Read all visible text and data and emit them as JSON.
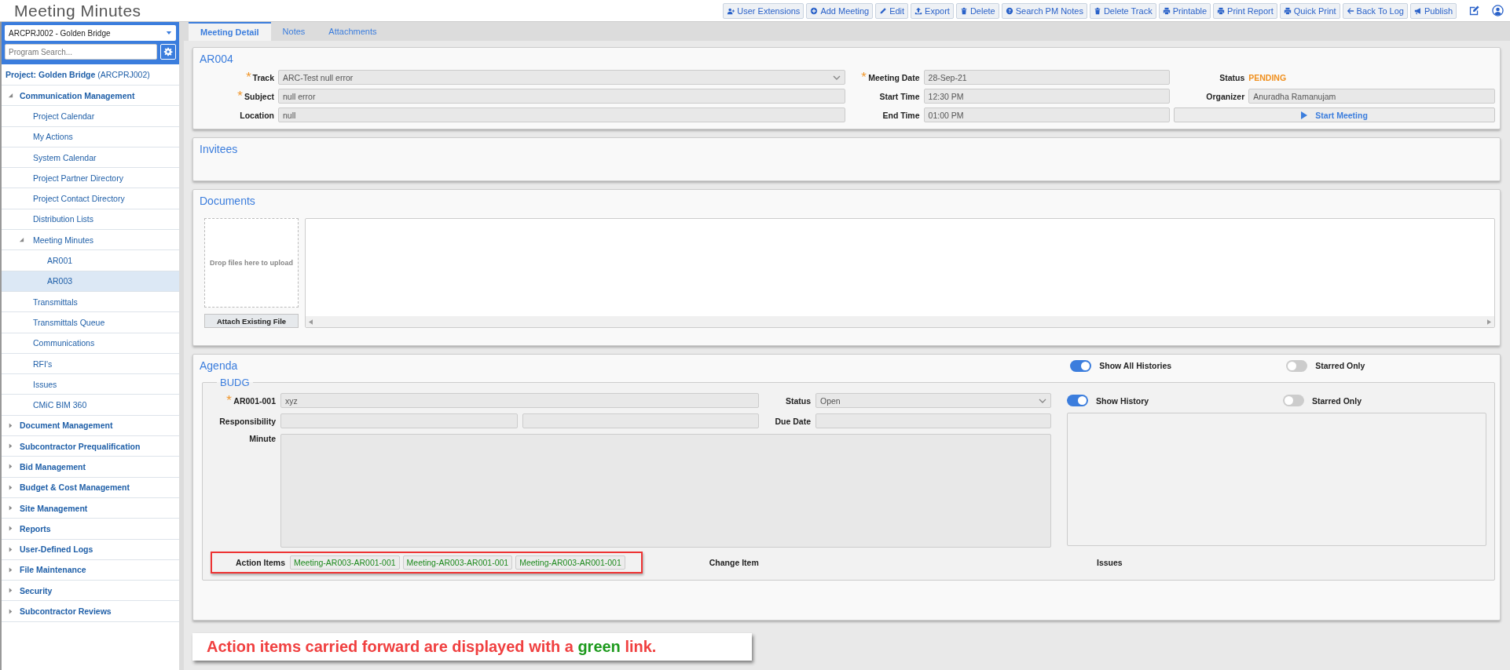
{
  "app_title": "Meeting Minutes",
  "toolbar": [
    {
      "label": "User Extensions"
    },
    {
      "label": "Add Meeting"
    },
    {
      "label": "Edit"
    },
    {
      "label": "Export"
    },
    {
      "label": "Delete"
    },
    {
      "label": "Search PM Notes"
    },
    {
      "label": "Delete Track"
    },
    {
      "label": "Printable"
    },
    {
      "label": "Print Report"
    },
    {
      "label": "Quick Print"
    },
    {
      "label": "Back To Log"
    },
    {
      "label": "Publish"
    }
  ],
  "sidebar": {
    "project_selector": "ARCPRJ002 - Golden Bridge",
    "search_placeholder": "Program Search...",
    "project_label": "**Project: Golden Bridge** (ARCPRJ002)",
    "tree": [
      {
        "label": "Communication Management",
        "expanded": true,
        "selected": false,
        "children": [
          {
            "label": "Project Calendar",
            "selected": false
          },
          {
            "label": "My Actions",
            "selected": false
          },
          {
            "label": "System Calendar",
            "selected": false
          },
          {
            "label": "Project Partner Directory",
            "selected": false
          },
          {
            "label": "Project Contact Directory",
            "selected": false
          },
          {
            "label": "Distribution Lists",
            "selected": false
          },
          {
            "label": "Meeting Minutes",
            "selected": false,
            "expanded": true,
            "children": [
              {
                "label": "AR001",
                "selected": false
              },
              {
                "label": "AR003",
                "selected": true
              }
            ]
          },
          {
            "label": "Transmittals",
            "selected": false
          },
          {
            "label": "Transmittals Queue",
            "selected": false
          },
          {
            "label": "Communications",
            "selected": false
          },
          {
            "label": "RFI's",
            "selected": false
          },
          {
            "label": "Issues",
            "selected": false
          },
          {
            "label": "CMiC BIM 360",
            "selected": false
          }
        ]
      },
      {
        "label": "Document Management",
        "expanded": false,
        "selected": false
      },
      {
        "label": "Subcontractor Prequalification",
        "expanded": false,
        "selected": false
      },
      {
        "label": "Bid Management",
        "expanded": false,
        "selected": false
      },
      {
        "label": "Budget & Cost Management",
        "expanded": false,
        "selected": false
      },
      {
        "label": "Site Management",
        "expanded": false,
        "selected": false
      },
      {
        "label": "Reports",
        "expanded": false,
        "selected": false
      },
      {
        "label": "User-Defined Logs",
        "expanded": false,
        "selected": false
      },
      {
        "label": "File Maintenance",
        "expanded": false,
        "selected": false
      },
      {
        "label": "Security",
        "expanded": false,
        "selected": false
      },
      {
        "label": "Subcontractor Reviews",
        "expanded": false,
        "selected": false
      }
    ]
  },
  "tabs": [
    {
      "label": "Meeting Detail",
      "selected": true
    },
    {
      "label": "Notes",
      "selected": false
    },
    {
      "label": "Attachments",
      "selected": false
    }
  ],
  "detail": {
    "title": "AR004",
    "fields": [
      {
        "label": "Track",
        "value": "ARC-Test null error",
        "required": true,
        "kind": "select"
      },
      {
        "label": "Meeting Date",
        "value": "28-Sep-21",
        "required": true,
        "kind": "text"
      },
      {
        "label": "Status",
        "value": "PENDING",
        "required": false,
        "kind": "status"
      },
      {
        "label": "Subject",
        "value": "null error",
        "required": true,
        "kind": "text"
      },
      {
        "label": "Start Time",
        "value": "12:30 PM",
        "required": false,
        "kind": "text"
      },
      {
        "label": "Organizer",
        "value": "Anuradha Ramanujam",
        "required": false,
        "kind": "text"
      },
      {
        "label": "Location",
        "value": "null",
        "required": false,
        "kind": "text"
      },
      {
        "label": "End Time",
        "value": "01:00 PM",
        "required": false,
        "kind": "text"
      }
    ],
    "start_button": "Start Meeting"
  },
  "invitees": {
    "title": "Invitees"
  },
  "documents": {
    "title": "Documents",
    "dropzone": "Drop files here to upload",
    "attach_button": "Attach Existing File"
  },
  "agenda": {
    "title": "Agenda",
    "toggles": [
      {
        "label": "Show All Histories",
        "on": true
      },
      {
        "label": "Starred Only",
        "on": false
      }
    ],
    "group": {
      "legend": "BUDG",
      "item_label": "AR001-001",
      "item_required": true,
      "item_value": "xyz",
      "status_label": "Status",
      "status_value": "Open",
      "toggles": [
        {
          "label": "Show History",
          "on": true
        },
        {
          "label": "Starred Only",
          "on": false
        }
      ],
      "responsibility_label": "Responsibility",
      "due_date_label": "Due Date",
      "minute_label": "Minute",
      "action_items_label": "Action Items",
      "action_items": [
        "Meeting-AR003-AR001-001",
        "Meeting-AR003-AR001-001",
        "Meeting-AR003-AR001-001"
      ],
      "change_item_label": "Change Item",
      "issues_label": "Issues"
    }
  },
  "callout": {
    "before": "Action items carried forward are displayed with a",
    "highlight": "green",
    "after": "link."
  }
}
